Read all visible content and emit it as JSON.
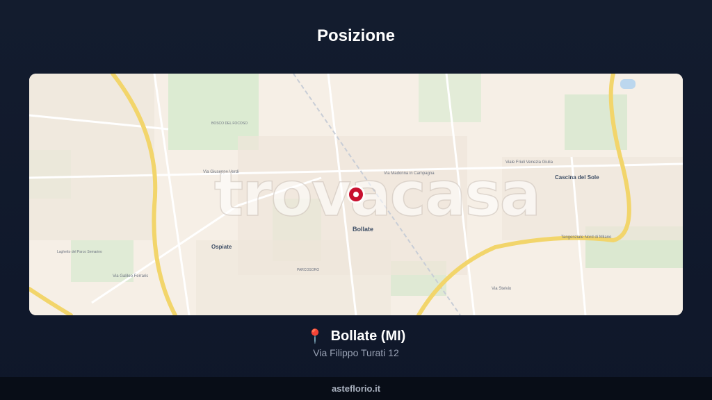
{
  "page": {
    "title": "Posizione"
  },
  "map": {
    "watermark": "trovacasa",
    "places": {
      "bollate": "Bollate",
      "ospiate": "Ospiate",
      "cascina_del_sole": "Cascina del Sole"
    },
    "streets": {
      "via_giuseppe_verdi": "Via Giuseppe Verdi",
      "via_madonna_in_campagna": "Via Madonna in Campagna",
      "viale_friuli": "Viale Friuli Venezia Giulia",
      "tangenziale_nord": "Tangenziale Nord di Milano",
      "via_galileo_ferraris": "Via Galileo Ferraris",
      "via_stelvio": "Via Stelvio",
      "parcosoro": "PARCOSORO",
      "bosco_del_fo": "BOSCO DEL FOCOSO",
      "laghetto": "Laghetto del Parco Semarino"
    }
  },
  "location": {
    "icon": "map-pin-icon",
    "city": "Bollate (MI)",
    "address": "Via Filippo Turati 12"
  },
  "footer": {
    "brand": "asteflorio.it"
  },
  "colors": {
    "background": "#0f172a",
    "pin": "#c8102e",
    "road_major": "#f2d56b"
  }
}
